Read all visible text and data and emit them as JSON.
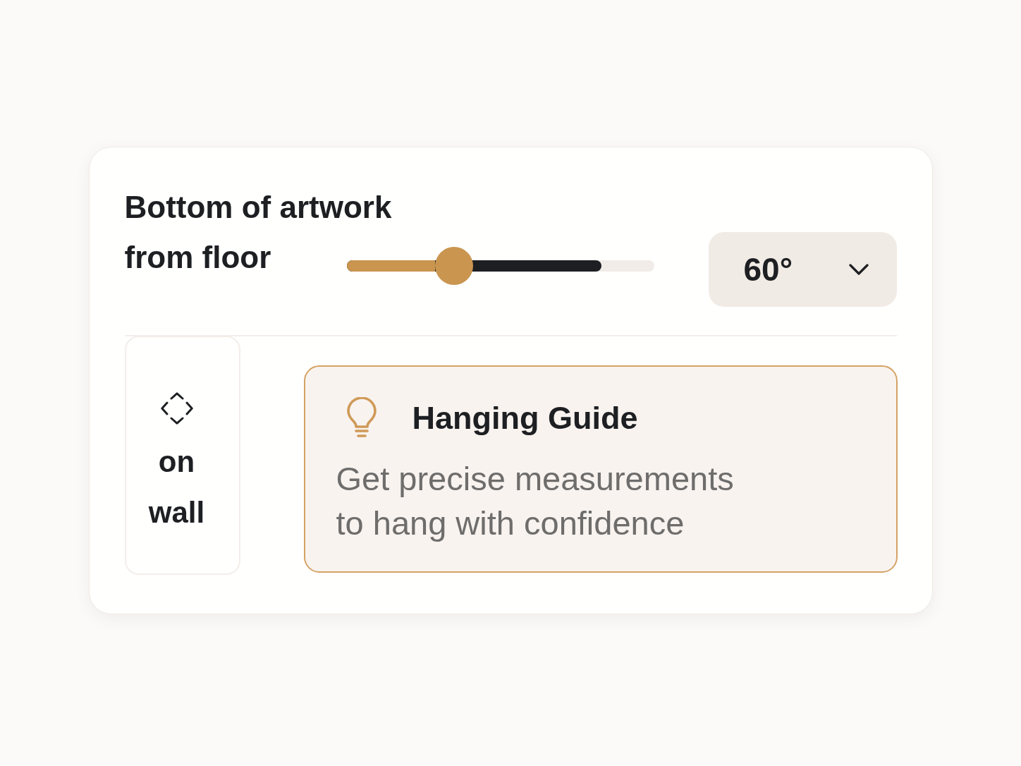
{
  "setting": {
    "label_lines": [
      "Bottom of artwork",
      "from floor"
    ],
    "slider": {
      "level": 0.35,
      "secondary": {
        "level": 0.83
      }
    },
    "dropdown": {
      "value": "60°"
    }
  },
  "placement_tile": {
    "label": "on wall"
  },
  "tip": {
    "title": "Hanging Guide",
    "text": "Get precise measurements to hang with confidence"
  }
}
